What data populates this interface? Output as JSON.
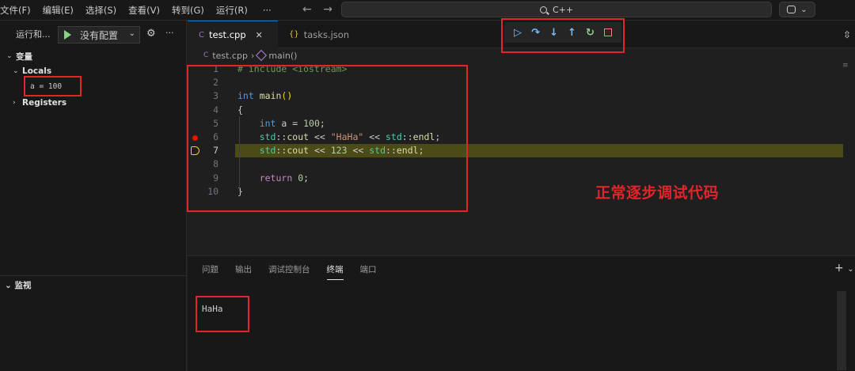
{
  "menubar": {
    "items": [
      "文件(F)",
      "编辑(E)",
      "选择(S)",
      "查看(V)",
      "转到(G)",
      "运行(R)"
    ],
    "more": "···"
  },
  "nav": {
    "back": "←",
    "forward": "→"
  },
  "command_center": {
    "text": "C++"
  },
  "sidebar": {
    "title": "运行和...",
    "config": "没有配置",
    "sections": {
      "variables": "变量",
      "locals": "Locals",
      "local_var": "a = 100",
      "registers": "Registers",
      "watch": "监视"
    }
  },
  "tabs": [
    {
      "label": "test.cpp",
      "icon": "c-file-icon",
      "active": true
    },
    {
      "label": "tasks.json",
      "icon": "json-file-icon",
      "active": false
    }
  ],
  "debug_toolbar": {
    "buttons": [
      "continue",
      "step-over",
      "step-into",
      "step-out",
      "restart",
      "stop"
    ]
  },
  "breadcrumb": {
    "file": "test.cpp",
    "symbol": "main()"
  },
  "code": {
    "current_line": 7,
    "breakpoint_line": 6,
    "lines": [
      {
        "n": "1",
        "text": "# include <iostream>"
      },
      {
        "n": "2",
        "text": ""
      },
      {
        "n": "3",
        "text": "int main()"
      },
      {
        "n": "4",
        "text": "{"
      },
      {
        "n": "5",
        "text": "    int a = 100;"
      },
      {
        "n": "6",
        "text": "    std::cout << \"HaHa\" << std::endl;"
      },
      {
        "n": "7",
        "text": "    std::cout << 123 << std::endl;"
      },
      {
        "n": "8",
        "text": ""
      },
      {
        "n": "9",
        "text": "    return 0;"
      },
      {
        "n": "10",
        "text": "}"
      }
    ]
  },
  "annotation": "正常逐步调试代码",
  "panel": {
    "tabs": [
      "问题",
      "输出",
      "调试控制台",
      "终端",
      "端口"
    ],
    "active_tab": "终端",
    "output": "HaHa"
  },
  "colors": {
    "highlight_box": "#e0262a",
    "current_line_bg": "#4b4b18",
    "breakpoint": "#e51400"
  }
}
